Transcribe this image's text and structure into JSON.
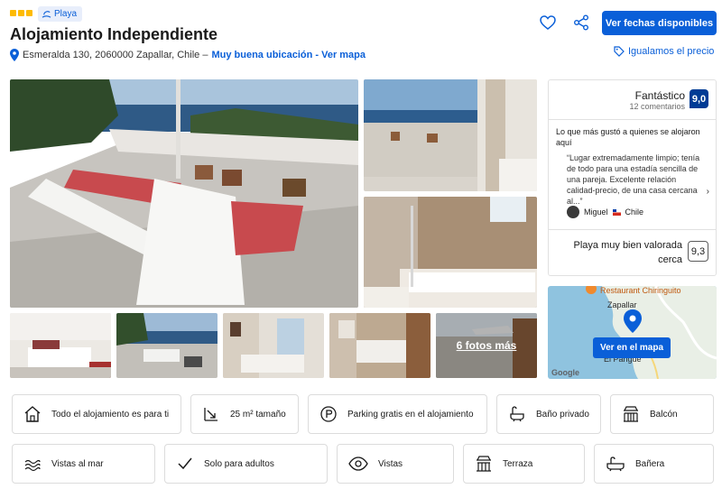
{
  "header": {
    "star_count": 3,
    "tag": "Playa",
    "title": "Alojamiento Independiente",
    "address": "Esmeralda 130, 2060000 Zapallar, Chile –",
    "location_link": "Muy buena ubicación - Ver mapa",
    "cta_label": "Ver fechas disponibles",
    "price_match": "Igualamos el precio",
    "accent_color": "#0a5fd8"
  },
  "gallery": {
    "more_photos_label": "6 fotos más"
  },
  "review": {
    "rating_word": "Fantástico",
    "review_count": "12 comentarios",
    "score": "9,0",
    "liked_heading": "Lo que más gustó a quienes se alojaron aquí",
    "quote": "“Lugar extremadamente limpio; tenía de todo para una estadía sencilla de una pareja. Excelente relación calidad-precio, de una casa cercana al...”",
    "reviewer_name": "Miguel",
    "reviewer_country": "Chile",
    "beach_label": "Playa muy bien valorada cerca",
    "beach_score": "9,3",
    "score_color": "#003b95"
  },
  "map": {
    "button_label": "Ver en el mapa",
    "label_restaurant": "Restaurant Chiringuito",
    "label_town": "Zapallar",
    "label_place": "El Pangue",
    "label_google": "Google"
  },
  "amenities": {
    "row1": [
      {
        "icon": "house-icon",
        "label": "Todo el alojamiento es para ti"
      },
      {
        "icon": "size-icon",
        "label": "25 m² tamaño"
      },
      {
        "icon": "parking-icon",
        "label": "Parking gratis en el alojamiento"
      },
      {
        "icon": "bath-icon",
        "label": "Baño privado"
      },
      {
        "icon": "balcony-icon",
        "label": "Balcón"
      }
    ],
    "row2": [
      {
        "icon": "sea-view-icon",
        "label": "Vistas al mar"
      },
      {
        "icon": "check-icon",
        "label": "Solo para adultos"
      },
      {
        "icon": "eye-icon",
        "label": "Vistas"
      },
      {
        "icon": "terrace-icon",
        "label": "Terraza"
      },
      {
        "icon": "bathtub-icon",
        "label": "Bañera"
      }
    ]
  }
}
